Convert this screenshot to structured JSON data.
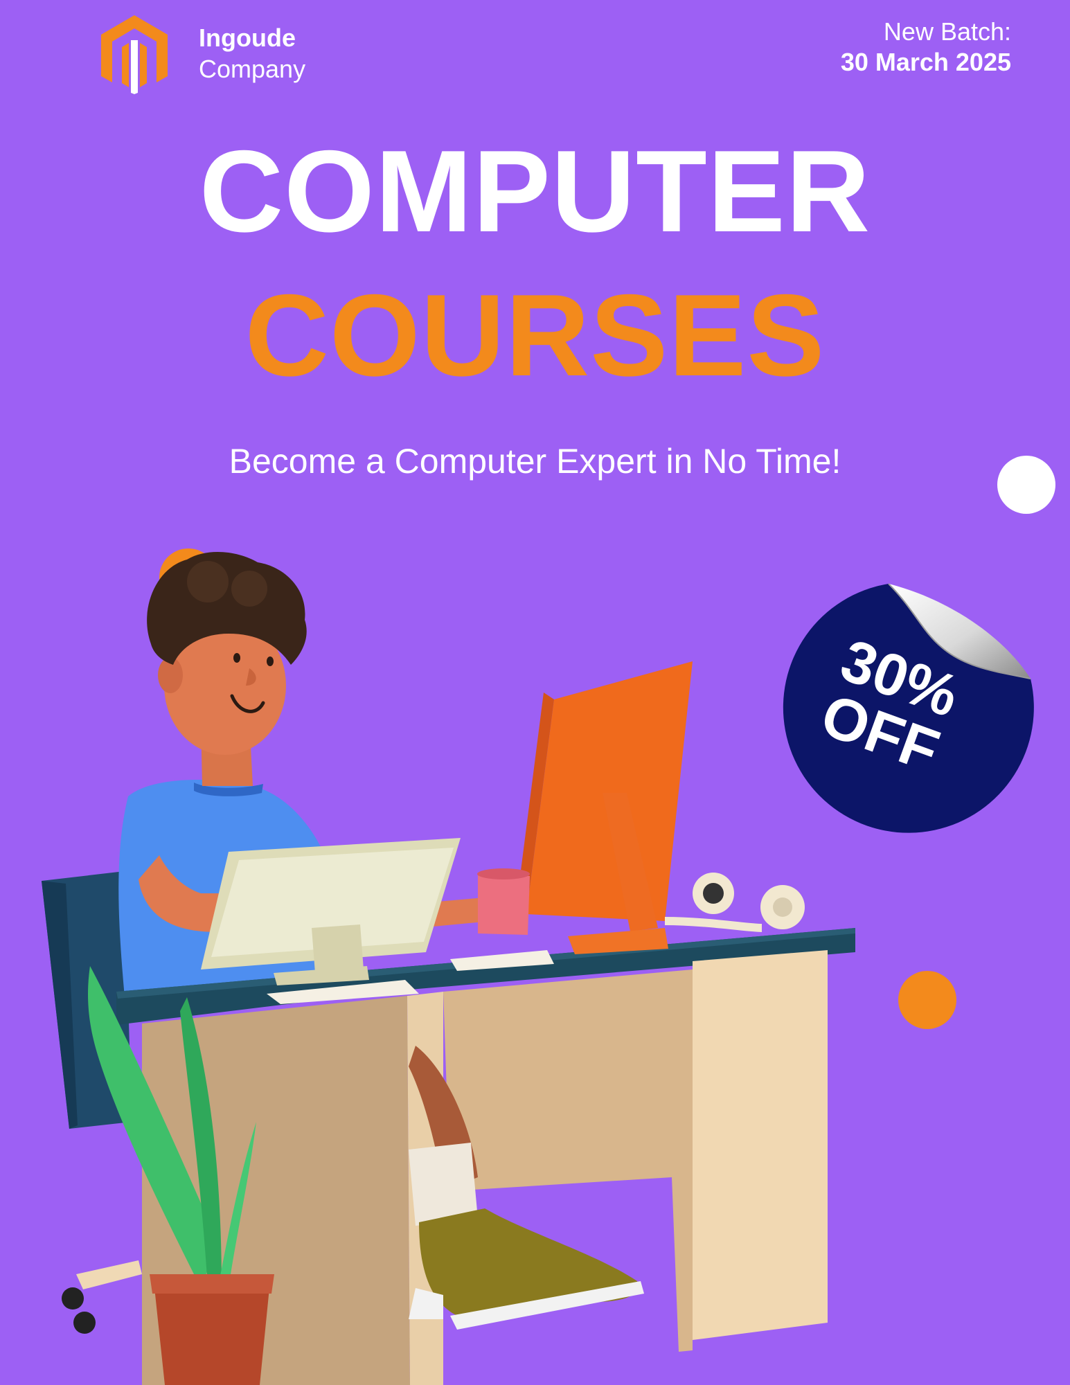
{
  "header": {
    "company_name": "Ingoude",
    "company_sub": "Company",
    "batch_label": "New Batch:",
    "batch_date": "30 March 2025"
  },
  "hero": {
    "title_line1": "COMPUTER",
    "title_line2": "COURSES",
    "tagline": "Become a Computer Expert in No Time!"
  },
  "badge": {
    "line1": "30%",
    "line2": "OFF"
  },
  "colors": {
    "background": "#9d60f4",
    "accent_orange": "#f38a1c",
    "badge_navy": "#0c1568",
    "text_white": "#ffffff"
  },
  "icons": {
    "logo": "company-logo-icon"
  },
  "illustration": "person-at-computer-desk"
}
